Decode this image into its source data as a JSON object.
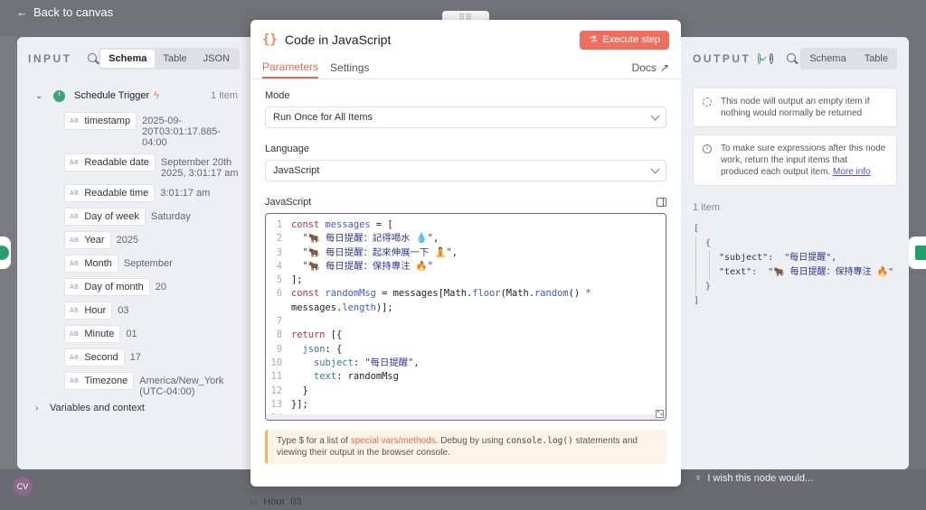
{
  "canvas": {
    "back_label": "Back to canvas",
    "drag_handle": "⠿⠿",
    "wish_label": "I wish this node would...",
    "bg_hour_label": "Hour",
    "bg_hour_value": "03",
    "bg_avatar": "CV"
  },
  "input": {
    "title": "INPUT",
    "views": [
      "Schema",
      "Table",
      "JSON"
    ],
    "active_view": "Schema",
    "trigger": {
      "label": "Schedule Trigger",
      "count": "1 item"
    },
    "fields": [
      {
        "type": "AB",
        "name": "timestamp",
        "value": "2025-09-20T03:01:17.885-04:00"
      },
      {
        "type": "AB",
        "name": "Readable date",
        "value": "September 20th 2025, 3:01:17 am"
      },
      {
        "type": "AB",
        "name": "Readable time",
        "value": "3:01:17 am"
      },
      {
        "type": "AB",
        "name": "Day of week",
        "value": "Saturday"
      },
      {
        "type": "AB",
        "name": "Year",
        "value": "2025"
      },
      {
        "type": "AB",
        "name": "Month",
        "value": "September"
      },
      {
        "type": "AB",
        "name": "Day of month",
        "value": "20"
      },
      {
        "type": "AB",
        "name": "Hour",
        "value": "03"
      },
      {
        "type": "AB",
        "name": "Minute",
        "value": "01"
      },
      {
        "type": "AB",
        "name": "Second",
        "value": "17"
      },
      {
        "type": "AB",
        "name": "Timezone",
        "value": "America/New_York (UTC-04:00)"
      }
    ],
    "vars_label": "Variables and context"
  },
  "modal": {
    "icon": "{}",
    "title": "Code in JavaScript",
    "execute_label": "Execute step",
    "tabs": [
      "Parameters",
      "Settings"
    ],
    "docs_label": "Docs",
    "mode_label": "Mode",
    "mode_value": "Run Once for All Items",
    "language_label": "Language",
    "language_value": "JavaScript",
    "editor_label": "JavaScript",
    "hint": {
      "pre": "Type $ for a list of ",
      "link": "special vars/methods",
      "mid": ". Debug by using ",
      "code": "console.log()",
      "post": " statements and viewing their output in the browser console."
    }
  },
  "code_lines": [
    {
      "n": "1",
      "html": "<span class=\"kw\">const</span> <span class=\"var\">messages</span> = ["
    },
    {
      "n": "2",
      "html": "  <span class=\"str\">\"🐂 每日提醒：記得喝水 💧\"</span>,"
    },
    {
      "n": "3",
      "html": "  <span class=\"str\">\"🐂 每日提醒：起來伸展一下 🧘\"</span>,"
    },
    {
      "n": "4",
      "html": "  <span class=\"str\">\"🐂 每日提醒：保持專注 🔥\"</span>"
    },
    {
      "n": "5",
      "html": "];"
    },
    {
      "n": "6",
      "html": "<span class=\"kw\">const</span> <span class=\"var\">randomMsg</span> = messages[Math.<span class=\"var\">floor</span>(Math.<span class=\"var\">random</span>() <span class=\"kw\">*</span>"
    },
    {
      "n": "",
      "html": "messages.<span class=\"var\">length</span>)];"
    },
    {
      "n": "7",
      "html": ""
    },
    {
      "n": "8",
      "html": "<span class=\"kw\">return</span> [{"
    },
    {
      "n": "9",
      "html": "  <span class=\"prop\">json</span>: {"
    },
    {
      "n": "10",
      "html": "    <span class=\"prop\">subject</span>: <span class=\"str\">\"每日提醒\"</span>,"
    },
    {
      "n": "11",
      "html": "    <span class=\"prop\">text</span>: randomMsg"
    },
    {
      "n": "12",
      "html": "  }"
    },
    {
      "n": "13",
      "html": "}];"
    },
    {
      "n": "14",
      "html": ""
    }
  ],
  "output": {
    "title": "OUTPUT",
    "views": [
      "Schema",
      "Table"
    ],
    "notice1": "This node will output an empty item if nothing would normally be returned",
    "notice2": "To make sure expressions after this node work, return the input items that produced each output item.",
    "more_info": "More info",
    "count": "1 item",
    "json": {
      "subject_key": "\"subject\"",
      "subject_val": "\"每日提醒\"",
      "text_key": "\"text\"",
      "text_val": "\"🐂 每日提醒：保持專注 🔥\""
    }
  }
}
